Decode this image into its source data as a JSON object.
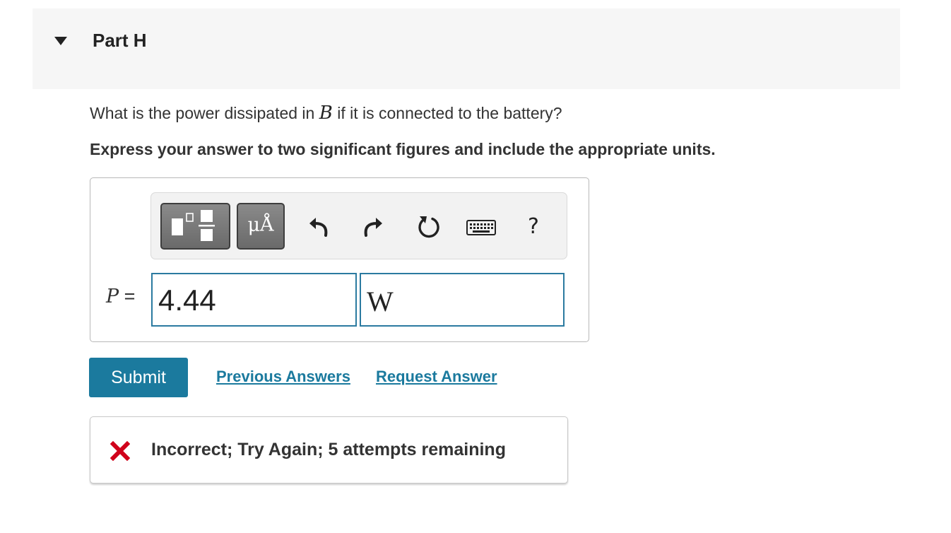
{
  "part": {
    "title": "Part H"
  },
  "question": {
    "before": "What is the power dissipated in ",
    "variable": "B",
    "after": " if it is connected to the battery?"
  },
  "instruction": "Express your answer to two significant figures and include the appropriate units.",
  "toolbar": {
    "units_label": "μÅ",
    "help_label": "?"
  },
  "answer": {
    "variable": "P",
    "equals": " =",
    "value": "4.44",
    "unit": "W"
  },
  "actions": {
    "submit_label": "Submit",
    "previous_answers_label": "Previous Answers",
    "request_answer_label": "Request Answer"
  },
  "feedback": {
    "message": "Incorrect; Try Again; 5 attempts remaining",
    "status_color": "#d0021b"
  },
  "colors": {
    "accent": "#1b7a9e",
    "field_border": "#2b7aa0",
    "header_bg": "#f6f6f6"
  }
}
